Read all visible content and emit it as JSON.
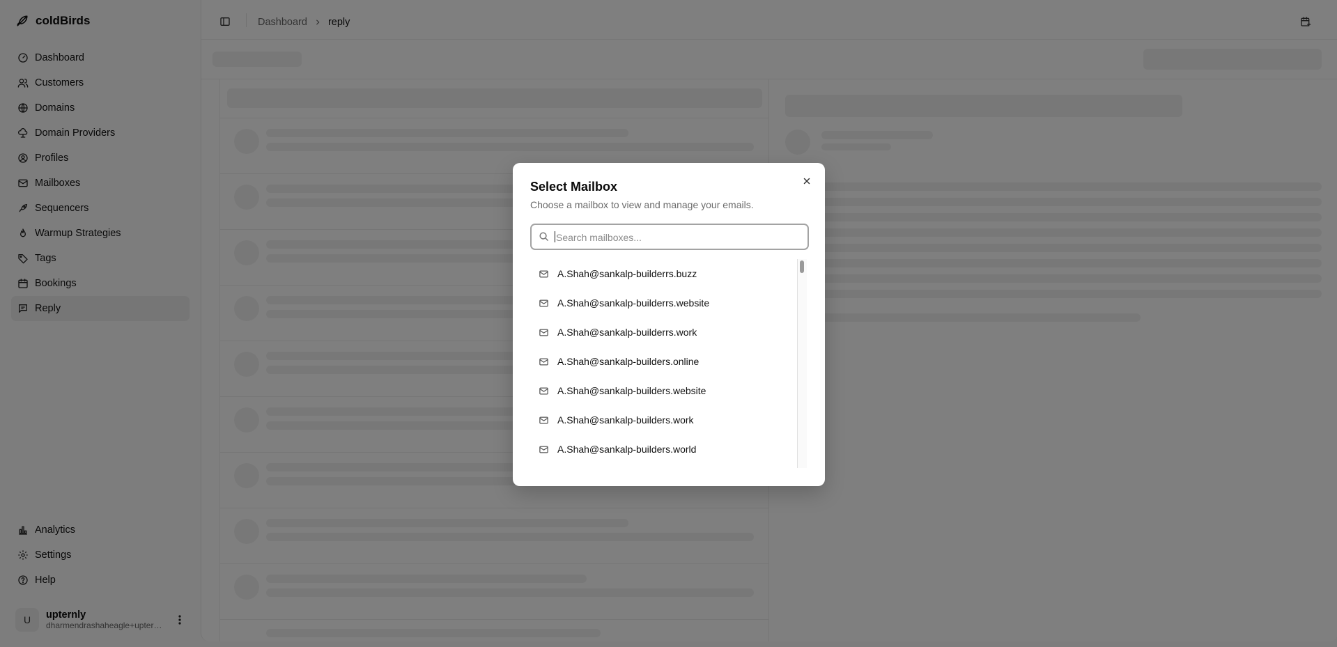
{
  "app": {
    "name": "coldBirds"
  },
  "sidebar": {
    "items": [
      {
        "label": "Dashboard",
        "icon": "gauge-icon"
      },
      {
        "label": "Customers",
        "icon": "users-icon"
      },
      {
        "label": "Domains",
        "icon": "globe-icon"
      },
      {
        "label": "Domain Providers",
        "icon": "cloud-icon"
      },
      {
        "label": "Profiles",
        "icon": "user-circle-icon"
      },
      {
        "label": "Mailboxes",
        "icon": "mail-icon"
      },
      {
        "label": "Sequencers",
        "icon": "rocket-icon"
      },
      {
        "label": "Warmup Strategies",
        "icon": "flame-icon"
      },
      {
        "label": "Tags",
        "icon": "tag-icon"
      },
      {
        "label": "Bookings",
        "icon": "calendar-icon"
      },
      {
        "label": "Reply",
        "icon": "message-icon",
        "active": true
      }
    ],
    "bottom_items": [
      {
        "label": "Analytics",
        "icon": "bar-chart-icon"
      },
      {
        "label": "Settings",
        "icon": "gear-icon"
      },
      {
        "label": "Help",
        "icon": "help-icon"
      }
    ],
    "user": {
      "initial": "U",
      "name": "upternly",
      "email": "dharmendrashaheagle+upternly@gmail.com"
    }
  },
  "header": {
    "breadcrumb": {
      "parent": "Dashboard",
      "current": "reply"
    }
  },
  "modal": {
    "title": "Select Mailbox",
    "description": "Choose a mailbox to view and manage your emails.",
    "search_placeholder": "Search mailboxes...",
    "mailboxes": [
      "A.Shah@sankalp-builderrs.buzz",
      "A.Shah@sankalp-builderrs.website",
      "A.Shah@sankalp-builderrs.work",
      "A.Shah@sankalp-builders.online",
      "A.Shah@sankalp-builders.website",
      "A.Shah@sankalp-builders.work",
      "A.Shah@sankalp-builders.world"
    ]
  }
}
